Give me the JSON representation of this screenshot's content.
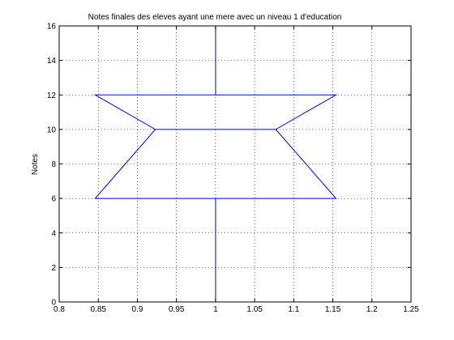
{
  "chart_data": {
    "type": "line",
    "title": "Notes finales des eleves ayant une mere avec un niveau 1 d'education",
    "xlabel": "",
    "ylabel": "Notes",
    "xlim": [
      0.8,
      1.25
    ],
    "ylim": [
      0,
      16
    ],
    "xticks": [
      "0.8",
      "0.85",
      "0.9",
      "0.95",
      "1",
      "1.05",
      "1.1",
      "1.15",
      "1.2",
      "1.25"
    ],
    "yticks": [
      "0",
      "2",
      "4",
      "6",
      "8",
      "10",
      "12",
      "14",
      "16"
    ],
    "grid": true,
    "grid_style": "dotted",
    "line_color": "#0000ff",
    "boxplot": {
      "position": 1.0,
      "lower_whisker": 0,
      "q1": 6,
      "median": 10,
      "q3": 12,
      "upper_whisker": 16,
      "box_left": 0.846,
      "box_right": 1.154,
      "notch_left": 0.923,
      "notch_right": 1.077
    }
  }
}
